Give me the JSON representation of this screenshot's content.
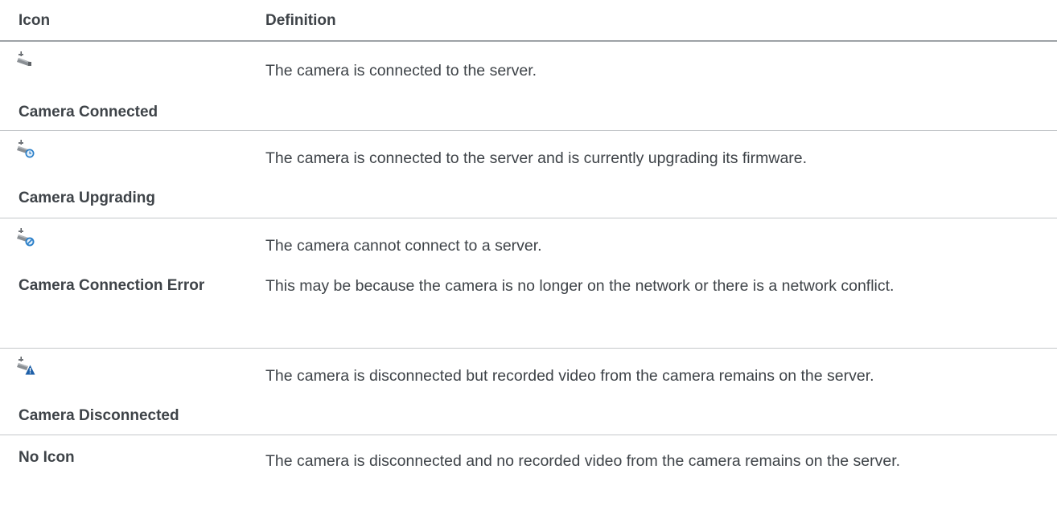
{
  "table": {
    "headers": {
      "icon": "Icon",
      "definition": "Definition"
    },
    "rows": [
      {
        "icon": "camera-connected-icon",
        "name": "Camera Connected",
        "definition": "The camera is connected to the server.",
        "definition_extra": ""
      },
      {
        "icon": "camera-upgrading-icon",
        "name": "Camera Upgrading",
        "definition": "The camera is connected to the server and is currently upgrading its firmware.",
        "definition_extra": ""
      },
      {
        "icon": "camera-connection-error-icon",
        "name": "Camera Connection Error",
        "definition": "The camera cannot connect to a server.",
        "definition_extra": "This may be because the camera is no longer on the network or there is a network conflict."
      },
      {
        "icon": "camera-disconnected-icon",
        "name": "Camera Disconnected",
        "definition": "The camera is disconnected but recorded video from the camera remains on the server.",
        "definition_extra": ""
      },
      {
        "icon": "",
        "name": "No Icon",
        "definition": "The camera is disconnected and no recorded video from the camera remains on the server.",
        "definition_extra": ""
      }
    ]
  },
  "colors": {
    "text": "#3e4348",
    "header_rule": "#9ea2a6",
    "row_rule": "#c4c7ca",
    "camera_gray": "#8a8f94",
    "status_blue": "#2a7fc9",
    "warning_blue": "#1d5fa8"
  }
}
